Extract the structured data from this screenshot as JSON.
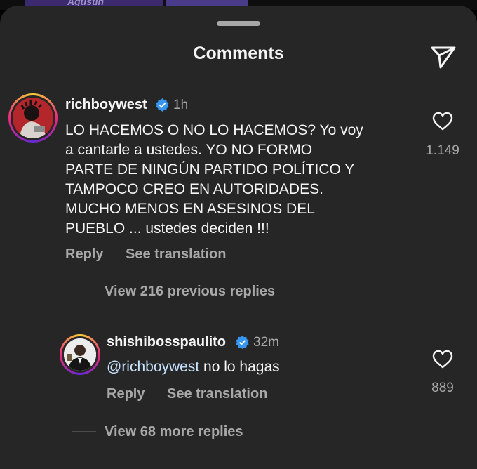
{
  "background": {
    "tile_text": "Agustín"
  },
  "header": {
    "title": "Comments",
    "share_icon": "paper-plane-icon"
  },
  "colors": {
    "sheet": "#262626",
    "text_primary": "#f5f5f5",
    "text_secondary": "#a8a8a8",
    "verified_blue": "#3797f0"
  },
  "comments": [
    {
      "username": "richboywest",
      "verified": true,
      "time": "1h",
      "text": "LO HACEMOS O NO LO HACEMOS? Yo voy\na cantarle a ustedes. YO NO FORMO\nPARTE DE NINGÚN PARTIDO POLÍTICO Y\nTAMPOCO CREO EN AUTORIDADES.\nMUCHO MENOS EN ASESINOS DEL\nPUEBLO ... ustedes deciden !!!",
      "likes": "1.149",
      "reply_label": "Reply",
      "translate_label": "See translation",
      "view_previous": "View 216 previous replies"
    },
    {
      "username": "shishibosspaulito",
      "verified": true,
      "time": "32m",
      "mention": "@richboywest",
      "text": " no lo hagas",
      "likes": "889",
      "reply_label": "Reply",
      "translate_label": "See translation",
      "view_more": "View 68 more replies"
    }
  ]
}
